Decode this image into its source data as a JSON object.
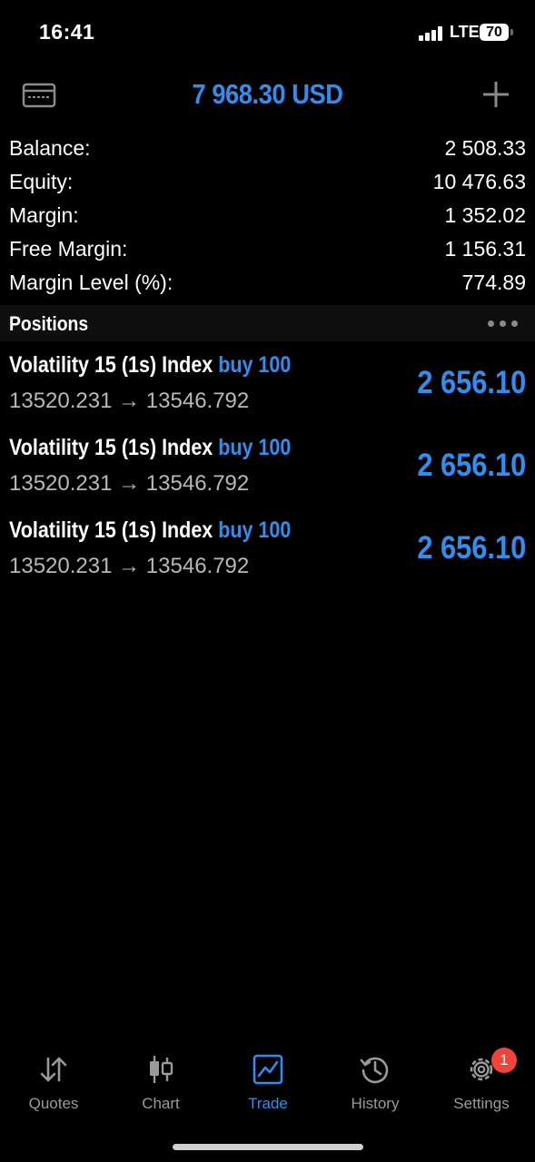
{
  "status_bar": {
    "time": "16:41",
    "network": "LTE",
    "battery": "70"
  },
  "header": {
    "title": "7 968.30 USD"
  },
  "summary": [
    {
      "label": "Balance:",
      "value": "2 508.33"
    },
    {
      "label": "Equity:",
      "value": "10 476.63"
    },
    {
      "label": "Margin:",
      "value": "1 352.02"
    },
    {
      "label": "Free Margin:",
      "value": "1 156.31"
    },
    {
      "label": "Margin Level (%):",
      "value": "774.89"
    }
  ],
  "positions_header": {
    "title": "Positions"
  },
  "positions": [
    {
      "symbol": "Volatility 15 (1s) Index",
      "type": "buy 100",
      "open_price": "13520.231",
      "arrow": "→",
      "current_price": "13546.792",
      "profit": "2 656.10"
    },
    {
      "symbol": "Volatility 15 (1s) Index",
      "type": "buy 100",
      "open_price": "13520.231",
      "arrow": "→",
      "current_price": "13546.792",
      "profit": "2 656.10"
    },
    {
      "symbol": "Volatility 15 (1s) Index",
      "type": "buy 100",
      "open_price": "13520.231",
      "arrow": "→",
      "current_price": "13546.792",
      "profit": "2 656.10"
    }
  ],
  "tabs": [
    {
      "label": "Quotes",
      "icon": "quotes-arrows-icon"
    },
    {
      "label": "Chart",
      "icon": "candlestick-chart-icon"
    },
    {
      "label": "Trade",
      "icon": "trade-line-chart-icon",
      "active": true
    },
    {
      "label": "History",
      "icon": "history-clock-icon"
    },
    {
      "label": "Settings",
      "icon": "settings-gear-icon"
    }
  ],
  "settings_badge": "1",
  "colors": {
    "accent": "#2f8ef0",
    "badge": "#f0443a",
    "muted": "#9a9a9a"
  }
}
